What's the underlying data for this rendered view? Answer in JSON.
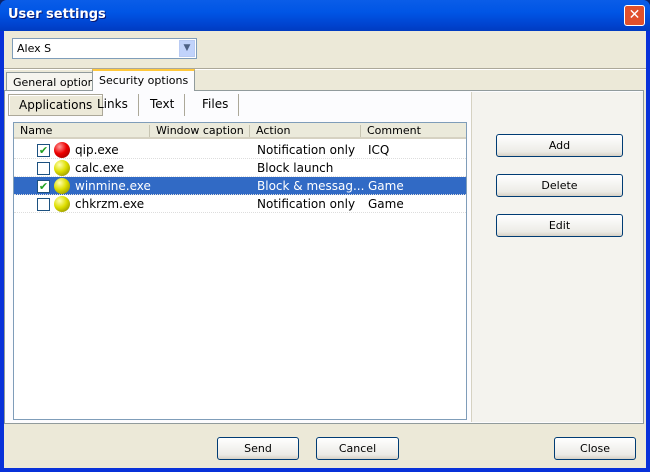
{
  "window": {
    "title": "User settings"
  },
  "user_select": {
    "value": "Alex S"
  },
  "tabs": [
    "General options",
    "Security options"
  ],
  "subtabs": [
    "Applications",
    "Links",
    "Text",
    "Files"
  ],
  "columns": [
    "Name",
    "Window caption",
    "Action",
    "Comment"
  ],
  "rows": [
    {
      "checked": true,
      "status": "red",
      "name": "qip.exe",
      "caption": "",
      "action": "Notification only",
      "comment": "ICQ"
    },
    {
      "checked": false,
      "status": "yellow",
      "name": "calc.exe",
      "caption": "",
      "action": "Block launch",
      "comment": ""
    },
    {
      "checked": true,
      "status": "yellow",
      "name": "winmine.exe",
      "caption": "",
      "action": "Block & messag...",
      "comment": "Game",
      "selected": true
    },
    {
      "checked": false,
      "status": "yellow",
      "name": "chkrzm.exe",
      "caption": "",
      "action": "Notification only",
      "comment": "Game"
    }
  ],
  "side_buttons": {
    "add": "Add",
    "delete": "Delete",
    "edit": "Edit"
  },
  "footer": {
    "send": "Send",
    "cancel": "Cancel",
    "close": "Close"
  },
  "close_glyph": "✕",
  "check_glyph": "✔",
  "dropdown_glyph": "▼"
}
